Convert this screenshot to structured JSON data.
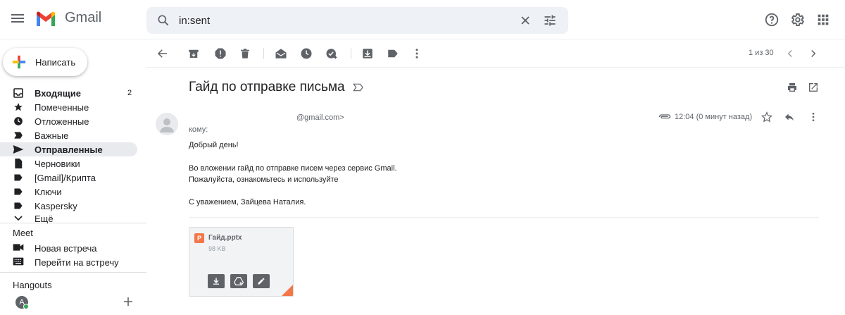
{
  "app": {
    "name": "Gmail"
  },
  "search": {
    "value": "in:sent"
  },
  "compose": {
    "label": "Написать"
  },
  "nav": {
    "items": [
      {
        "label": "Входящие",
        "count": "2",
        "icon": "inbox-icon"
      },
      {
        "label": "Помеченные",
        "icon": "star-icon"
      },
      {
        "label": "Отложенные",
        "icon": "clock-icon"
      },
      {
        "label": "Важные",
        "icon": "important-icon"
      },
      {
        "label": "Отправленные",
        "icon": "send-icon"
      },
      {
        "label": "Черновики",
        "icon": "draft-icon"
      },
      {
        "label": "[Gmail]/Крипта",
        "icon": "label-icon"
      },
      {
        "label": "Ключи",
        "icon": "label-icon"
      },
      {
        "label": "Kaspersky",
        "icon": "label-icon"
      },
      {
        "label": "Ещё",
        "icon": "chevron-down-icon"
      }
    ]
  },
  "meet": {
    "title": "Meet",
    "new_meeting": "Новая встреча",
    "join_meeting": "Перейти на встречу"
  },
  "hangouts": {
    "title": "Hangouts",
    "avatar_letter": "A"
  },
  "toolbar": {
    "pager": "1 из 30"
  },
  "message": {
    "subject": "Гайд по отправке письма",
    "sender": "@gmail.com>",
    "to": "кому:",
    "time": "12:04 (0 минут назад)",
    "greeting": "Добрый день!",
    "line1": "Во вложении гайд по отправке писем через сервис Gmail.",
    "line2": "Пожалуйста, ознакомьтесь и используйте",
    "signature": "С уважением, Зайцева Наталия."
  },
  "attachment": {
    "name": "Гайд.pptx",
    "size": "98 KB",
    "type_letter": "P"
  },
  "colors": {
    "active_nav": "#e8eaed",
    "accent_red": "#ea4335",
    "pptx_orange": "#f4774a"
  }
}
